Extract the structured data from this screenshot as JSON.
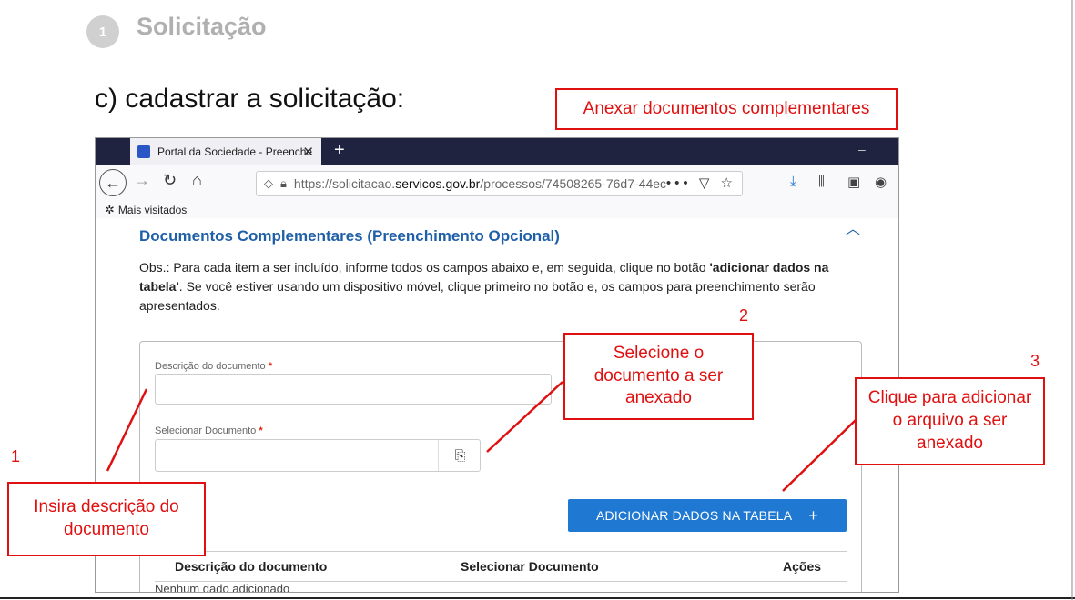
{
  "slide": {
    "step_number": "1",
    "step_title": "Solicitação",
    "subtitle": "c) cadastrar a solicitação:"
  },
  "callouts": {
    "top": "Anexar documentos complementares",
    "select_doc": "Selecione o documento a ser anexado",
    "click_add": "Clique para adicionar o arquivo a ser anexado",
    "insert_desc": "Insira descrição do documento"
  },
  "markers": {
    "m1": "1",
    "m2": "2",
    "m3": "3"
  },
  "browser": {
    "tab_title": "Portal da Sociedade - Preenche",
    "tab_close": "✕",
    "new_tab": "+",
    "minimize": "–",
    "url_prefix": "https://solicitacao.",
    "url_domain": "servicos.gov.br",
    "url_suffix": "/processos/74508265-76d7-44ec-",
    "url_more": "•••",
    "bookmark_label": "Mais visitados"
  },
  "page": {
    "section_title": "Documentos Complementares (Preenchimento Opcional)",
    "obs_part1": "Obs.: Para cada item a ser incluído, informe todos os campos abaixo e, em seguida, clique no botão ",
    "obs_bold": "'adicionar dados na tabela'",
    "obs_part2": ". Se você estiver usando um dispositivo móvel, clique primeiro no botão e, os campos para preenchimento serão apresentados.",
    "field_desc_label": "Descrição do documento",
    "field_doc_label": "Selecionar Documento",
    "required_mark": "*",
    "add_button_label": "ADICIONAR DADOS NA TABELA",
    "add_button_icon": "+",
    "table_headers": [
      "Descrição do documento",
      "Selecionar Documento",
      "Ações"
    ],
    "empty_row_text": "Nenhum dado adicionado"
  },
  "colors": {
    "callout_red": "#e01010",
    "section_blue": "#1f5fa8",
    "button_blue": "#1f78d1",
    "tabbar_dark": "#202340"
  }
}
